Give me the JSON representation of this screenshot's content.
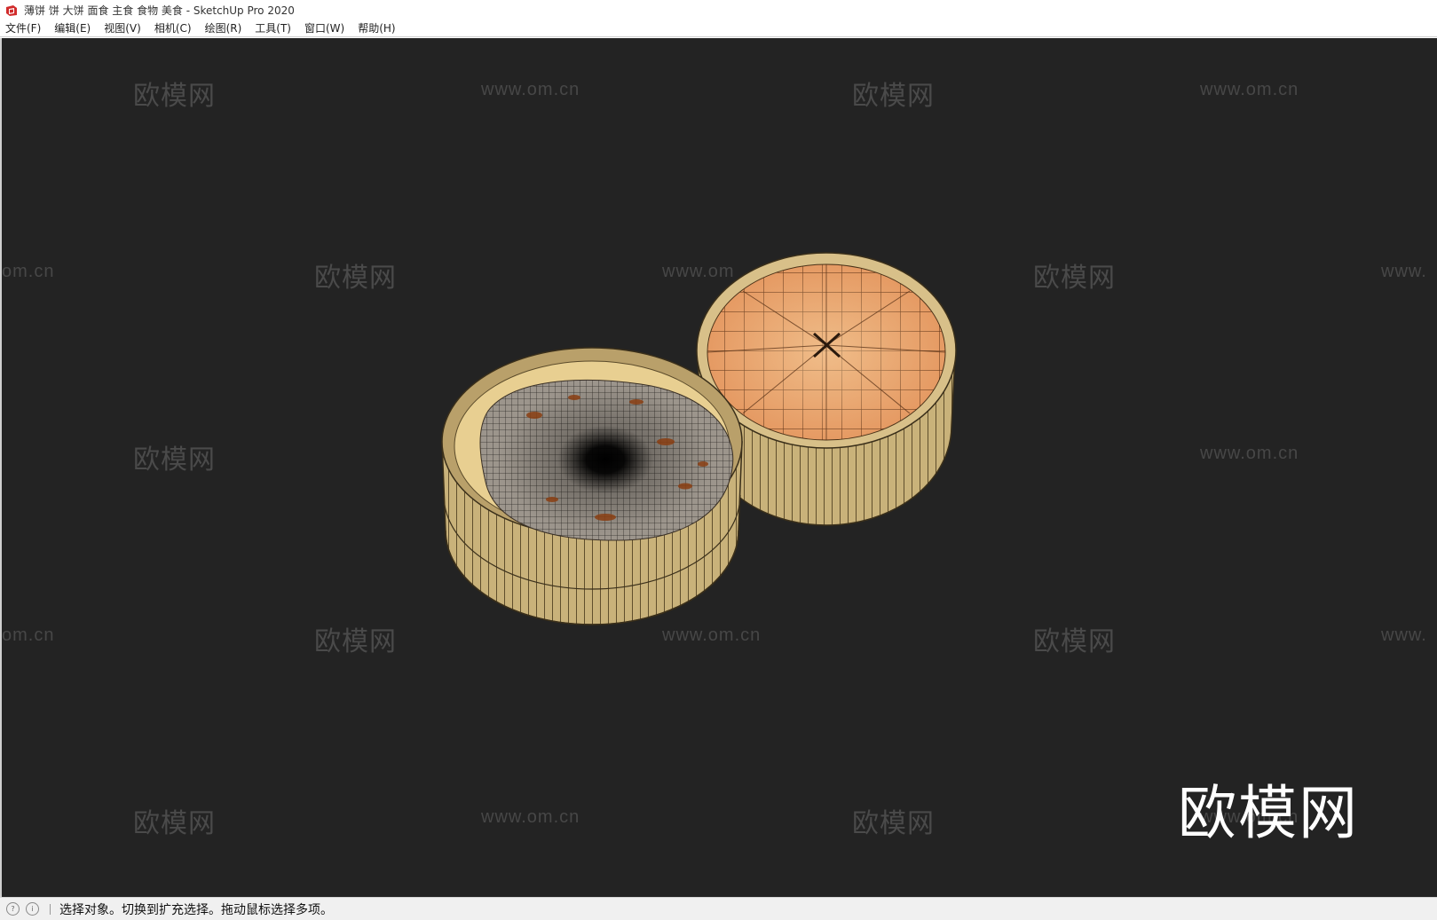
{
  "window": {
    "title": "薄饼 饼 大饼 面食 主食 食物 美食 - SketchUp Pro 2020",
    "app_icon": "sketchup-logo-icon"
  },
  "menu": [
    {
      "label": "文件(F)"
    },
    {
      "label": "编辑(E)"
    },
    {
      "label": "视图(V)"
    },
    {
      "label": "相机(C)"
    },
    {
      "label": "绘图(R)"
    },
    {
      "label": "工具(T)"
    },
    {
      "label": "窗口(W)"
    },
    {
      "label": "帮助(H)"
    }
  ],
  "viewport": {
    "background": "#232323",
    "watermarks": {
      "brand": "欧模网",
      "url": "www.om.cn",
      "url_fragment_left": "om.cn",
      "url_fragment_right": "www.",
      "url_fragment_mid": "www.om"
    },
    "logo": "欧模网"
  },
  "status": {
    "icons": [
      "geo-location-icon",
      "info-icon"
    ],
    "text": "选择对象。切换到扩充选择。拖动鼠标选择多项。"
  }
}
